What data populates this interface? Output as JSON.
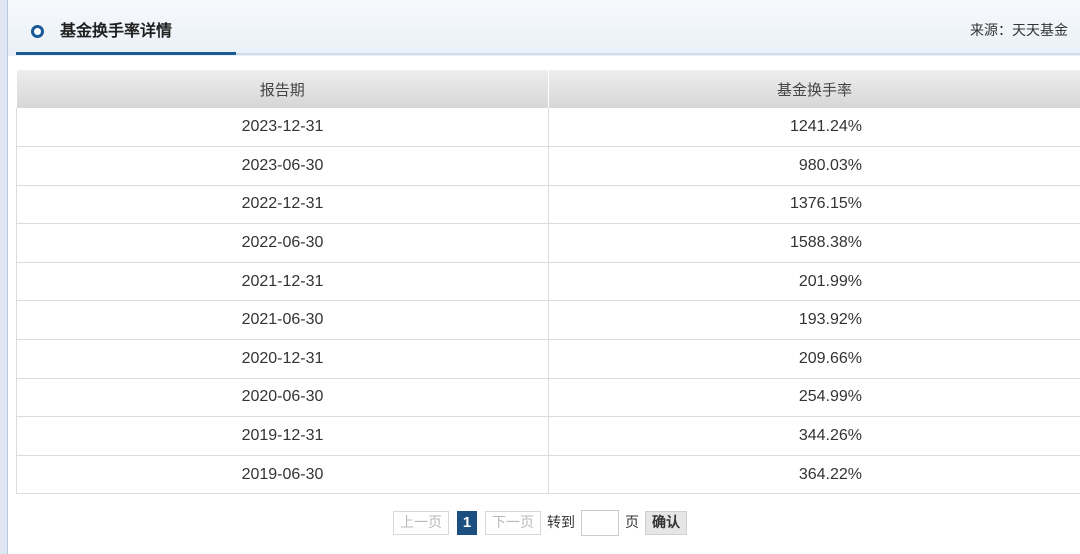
{
  "panel": {
    "title": "基金换手率详情",
    "source": "来源：天天基金"
  },
  "table": {
    "headers": [
      "报告期",
      "基金换手率"
    ],
    "rows": [
      {
        "date": "2023-12-31",
        "rate": "1241.24%"
      },
      {
        "date": "2023-06-30",
        "rate": "980.03%"
      },
      {
        "date": "2022-12-31",
        "rate": "1376.15%"
      },
      {
        "date": "2022-06-30",
        "rate": "1588.38%"
      },
      {
        "date": "2021-12-31",
        "rate": "201.99%"
      },
      {
        "date": "2021-06-30",
        "rate": "193.92%"
      },
      {
        "date": "2020-12-31",
        "rate": "209.66%"
      },
      {
        "date": "2020-06-30",
        "rate": "254.99%"
      },
      {
        "date": "2019-12-31",
        "rate": "344.26%"
      },
      {
        "date": "2019-06-30",
        "rate": "364.22%"
      }
    ]
  },
  "pager": {
    "prev_label": "上一页",
    "current_page": "1",
    "next_label": "下一页",
    "goto_label": "转到",
    "page_unit": "页",
    "page_input_value": "",
    "confirm_label": "确认"
  },
  "colors": {
    "accent": "#1a5a96",
    "current_page_bg": "#1c4e80"
  },
  "icons": {
    "title_marker": "circle-icon"
  }
}
